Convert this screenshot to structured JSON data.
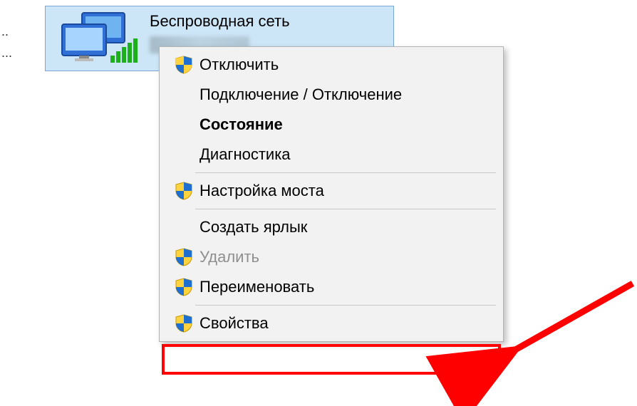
{
  "dots1": "..",
  "dots2": "...",
  "adapter": {
    "title": "Беспроводная сеть"
  },
  "menu": {
    "disable": "Отключить",
    "connect": "Подключение / Отключение",
    "status": "Состояние",
    "diagnose": "Диагностика",
    "bridge": "Настройка моста",
    "shortcut": "Создать ярлык",
    "delete": "Удалить",
    "rename": "Переименовать",
    "properties": "Свойства"
  },
  "icons": {
    "shield": "shield-icon",
    "network": "network-adapter-icon"
  }
}
